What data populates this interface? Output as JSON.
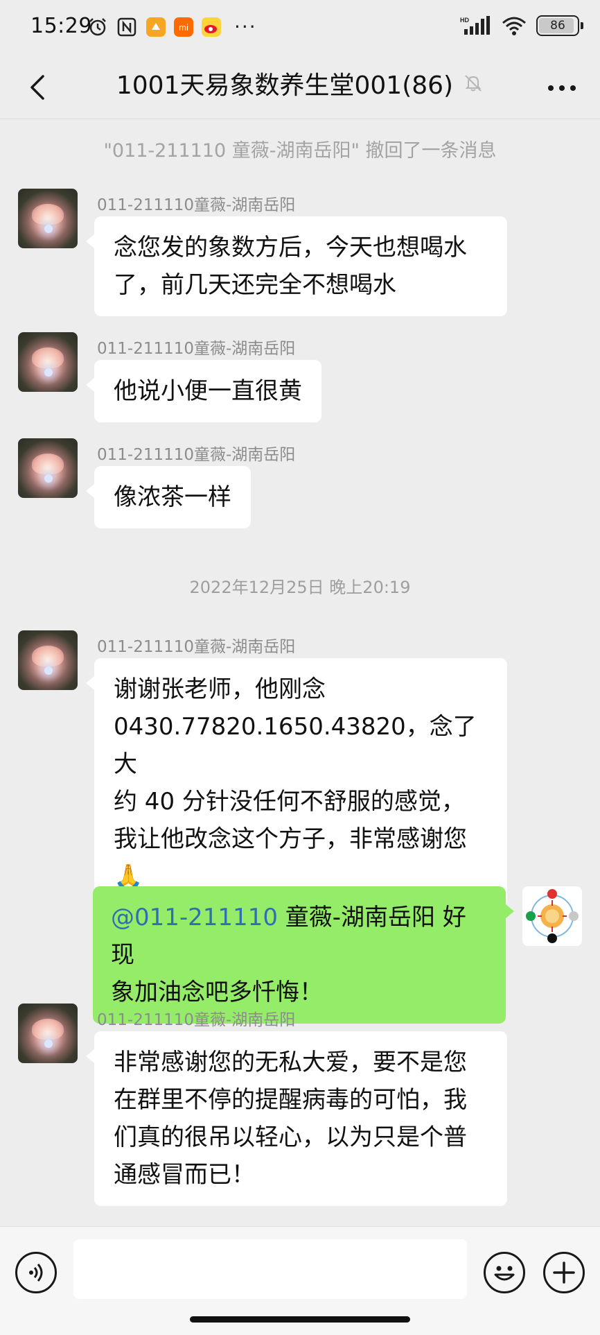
{
  "status_bar": {
    "time": "15:29",
    "battery": "86",
    "battery_level": 0.86
  },
  "nav": {
    "title": "1001天易象数养生堂001(86)"
  },
  "system_note": "\"011-211110 童薇-湖南岳阳\" 撤回了一条消息",
  "time_divider": "2022年12月25日 晚上20:19",
  "messages": [
    {
      "sender": "011-211110童薇-湖南岳阳",
      "lines": [
        "念您发的象数方后，今天也想喝水",
        "了，前几天还完全不想喝水"
      ]
    },
    {
      "sender": "011-211110童薇-湖南岳阳",
      "lines": [
        "他说小便一直很黄"
      ]
    },
    {
      "sender": "011-211110童薇-湖南岳阳",
      "lines": [
        "像浓茶一样"
      ]
    },
    {
      "sender": "011-211110童薇-湖南岳阳",
      "lines": [
        "谢谢张老师，他刚念",
        "0430.77820.1650.43820，念了大",
        "约 40 分针没任何不舒服的感觉，",
        "我让他改念这个方子，非常感谢您",
        "🙏"
      ]
    },
    {
      "sender": "011-211110童薇-湖南岳阳",
      "lines": [
        "非常感谢您的无私大爱，要不是您",
        "在群里不停的提醒病毒的可怕，我",
        "们真的很吊以轻心，以为只是个普",
        "通感冒而已！"
      ]
    }
  ],
  "outgoing": {
    "mention": "@011-211110",
    "line1_rest": " 童薇-湖南岳阳  好现",
    "line2": "象加油念吧多忏悔！"
  },
  "input": {
    "placeholder": ""
  },
  "icons": {
    "back": "back-arrow-icon",
    "mute": "bell-off-icon",
    "more": "more-dots-icon",
    "voice": "voice-icon",
    "emoji": "emoji-icon",
    "plus": "plus-icon"
  }
}
